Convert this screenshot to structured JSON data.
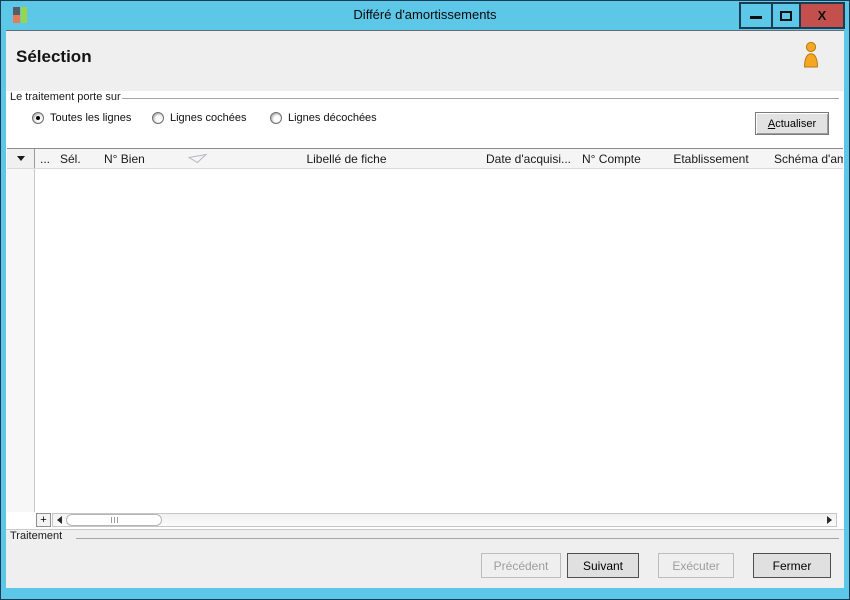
{
  "window": {
    "title": "Différé d'amortissements",
    "close_glyph": "X"
  },
  "selection_section": {
    "title": "Sélection"
  },
  "treatment_filter": {
    "group_label": "Le traitement porte sur",
    "options": [
      {
        "label": "Toutes les lignes",
        "selected": true
      },
      {
        "label": "Lignes cochées",
        "selected": false
      },
      {
        "label": "Lignes décochées",
        "selected": false
      }
    ],
    "refresh_button_label": "Actualiser"
  },
  "grid": {
    "corner_icon": "dropdown-arrow-icon",
    "columns": [
      {
        "label": "...",
        "sort_glyph": false
      },
      {
        "label": "Sél.",
        "sort_glyph": false
      },
      {
        "label": "N° Bien",
        "sort_glyph": true
      },
      {
        "label": "Libellé de fiche",
        "sort_glyph": false
      },
      {
        "label": "Date d'acquisi...",
        "sort_glyph": false
      },
      {
        "label": "N° Compte",
        "sort_glyph": false
      },
      {
        "label": "Etablissement",
        "sort_glyph": false
      },
      {
        "label": "Schéma d'am",
        "sort_glyph": false
      }
    ],
    "rows": [],
    "add_row_button_label": "+"
  },
  "footer": {
    "group_label": "Traitement",
    "buttons": [
      {
        "label": "Précédent",
        "enabled": false
      },
      {
        "label": "Suivant",
        "enabled": true
      },
      {
        "label": "Exécuter",
        "enabled": false
      },
      {
        "label": "Fermer",
        "enabled": true
      }
    ]
  },
  "colors": {
    "titlebar_blue": "#5DC7E8",
    "close_red": "#C4504E",
    "user_icon_orange": "#F5A623",
    "app_icon_green": "#9CD449",
    "app_icon_orange": "#E87B53"
  }
}
